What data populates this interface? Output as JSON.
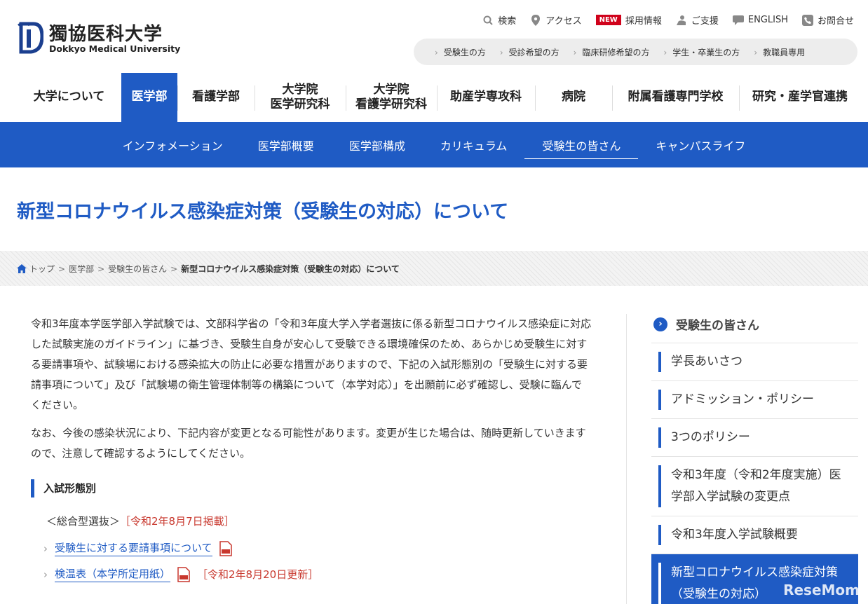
{
  "header": {
    "logo_jp": "獨協医科大学",
    "logo_en": "Dokkyo Medical University",
    "util": [
      {
        "label": "検索",
        "icon": "search-icon"
      },
      {
        "label": "アクセス",
        "icon": "location-pin-icon"
      },
      {
        "label": "採用情報",
        "badge": "NEW"
      },
      {
        "label": "ご支援",
        "icon": "support-icon"
      },
      {
        "label": "ENGLISH",
        "icon": "speech-bubble-icon"
      },
      {
        "label": "お問合せ",
        "icon": "phone-icon"
      }
    ],
    "audience": [
      "受験生の方",
      "受診希望の方",
      "臨床研修希望の方",
      "学生・卒業生の方",
      "教職員専用"
    ]
  },
  "mainnav": [
    {
      "label": "大学について"
    },
    {
      "label": "医学部",
      "active": true
    },
    {
      "label": "看護学部"
    },
    {
      "label": "大学院\n医学研究科"
    },
    {
      "label": "大学院\n看護学研究科"
    },
    {
      "label": "助産学専攻科"
    },
    {
      "label": "病院"
    },
    {
      "label": "附属看護専門学校"
    },
    {
      "label": "研究・産学官連携"
    }
  ],
  "subnav": [
    {
      "label": "インフォメーション"
    },
    {
      "label": "医学部概要"
    },
    {
      "label": "医学部構成"
    },
    {
      "label": "カリキュラム"
    },
    {
      "label": "受験生の皆さん",
      "active": true
    },
    {
      "label": "キャンパスライフ"
    }
  ],
  "page_title": "新型コロナウイルス感染症対策（受験生の対応）について",
  "breadcrumb": {
    "items": [
      "トップ",
      "医学部",
      "受験生の皆さん"
    ],
    "current": "新型コロナウイルス感染症対策（受験生の対応）について",
    "sep": ">"
  },
  "content": {
    "para1": "令和3年度本学医学部入学試験では、文部科学省の「令和3年度大学入学者選抜に係る新型コロナウイルス感染症に対応した試験実施のガイドライン」に基づき、受験生自身が安心して受験できる環境確保のため、あらかじめ受験生に対する要請事項や、試験場における感染拡大の防止に必要な措置がありますので、下記の入試形態別の「受験生に対する要請事項について」及び「試験場の衛生管理体制等の構築について（本学対応）」を出願前に必ず確認し、受験に臨んでください。",
    "para2": "なお、今後の感染状況により、下記内容が変更となる可能性があります。変更が生じた場合は、随時更新していきますので、注意して確認するようにしてください。",
    "section_heading": "入試形態別",
    "selection_name": "＜総合型選抜＞",
    "selection_note": "［令和2年8月7日掲載］",
    "link1": "受験生に対する要請事項について",
    "link2": "検温表（本学所定用紙）",
    "link2_note": "［令和2年8月20日更新］"
  },
  "sidebar": {
    "heading": "受験生の皆さん",
    "items": [
      {
        "label": "学長あいさつ"
      },
      {
        "label": "アドミッション・ポリシー"
      },
      {
        "label": "3つのポリシー"
      },
      {
        "label": "令和3年度（令和2年度実施）医学部入学試験の変更点"
      },
      {
        "label": "令和3年度入学試験概要"
      },
      {
        "label": "新型コロナウイルス感染症対策（受験生の対応）",
        "active": true
      }
    ]
  },
  "watermark": "ReseMom",
  "colors": {
    "brand_blue": "#1f5bc4",
    "note_red": "#c8372d",
    "new_badge": "#d0021b"
  }
}
